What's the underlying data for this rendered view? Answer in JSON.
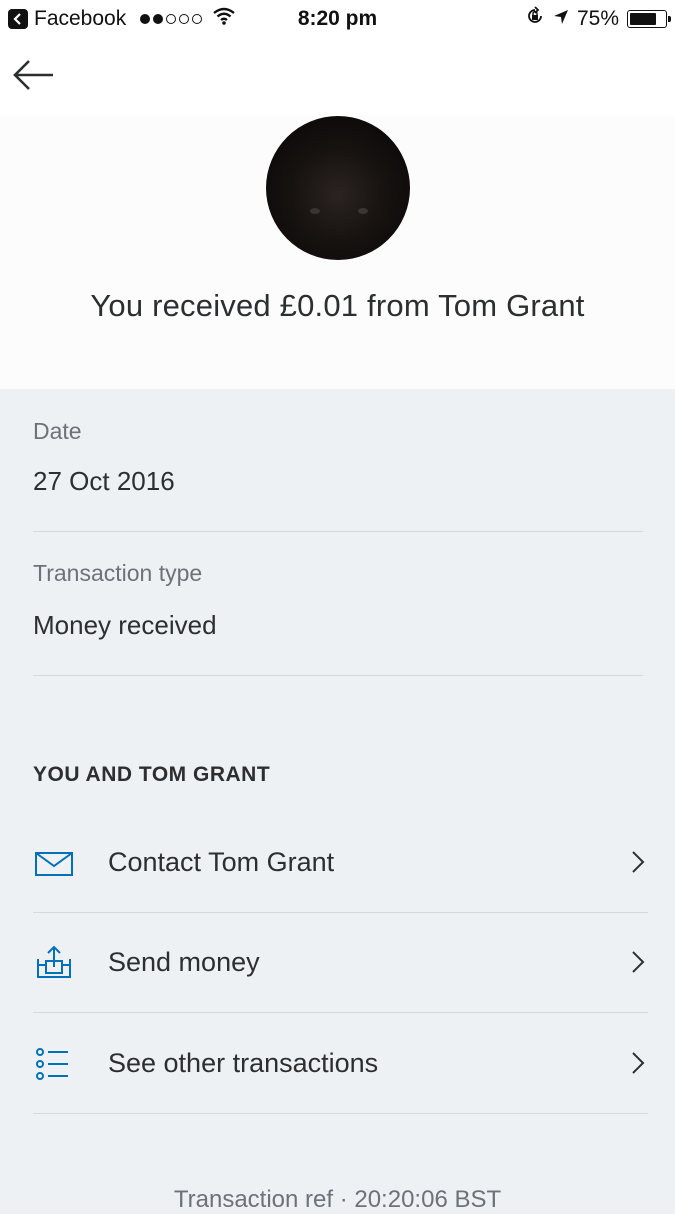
{
  "status_bar": {
    "app_back_label": "Facebook",
    "time": "8:20 pm",
    "battery_percent_text": "75%",
    "battery_level": 0.75
  },
  "header": {
    "title": "You received £0.01 from Tom Grant"
  },
  "details": [
    {
      "label": "Date",
      "value": "27 Oct 2016"
    },
    {
      "label": "Transaction type",
      "value": "Money received"
    }
  ],
  "section": {
    "heading": "YOU AND TOM GRANT",
    "actions": [
      {
        "label": "Contact Tom Grant",
        "icon": "envelope-icon"
      },
      {
        "label": "Send money",
        "icon": "send-money-icon"
      },
      {
        "label": "See other transactions",
        "icon": "list-icon"
      }
    ]
  },
  "footer": {
    "text": "Transaction ref  ·  20:20:06 BST"
  },
  "colors": {
    "accent": "#0070ba",
    "background": "#eef1f4",
    "text": "#2c2e2f",
    "muted": "#6c7378"
  }
}
